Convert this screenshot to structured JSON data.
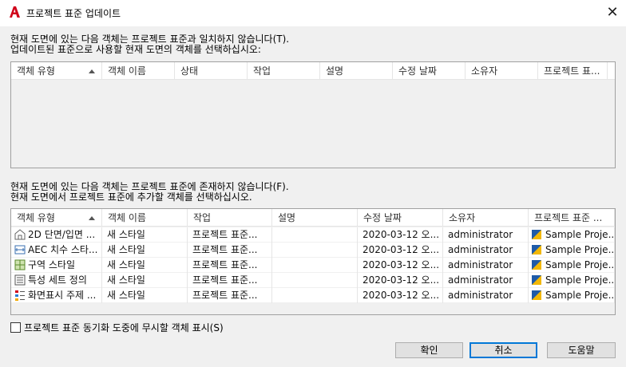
{
  "window": {
    "title": "프로젝트 표준 업데이트",
    "close_glyph": "✕"
  },
  "section1": {
    "prompt_line1": "현재 도면에 있는 다음 객체는 프로젝트 표준과 일치하지 않습니다(T).",
    "prompt_line2": "업데이트된 표준으로 사용할 현재 도면의 객체를 선택하십시오:",
    "columns": [
      "객체 유형",
      "객체 이름",
      "상태",
      "작업",
      "설명",
      "수정 날짜",
      "소유자",
      "프로젝트 표..."
    ]
  },
  "section2": {
    "prompt_line1": "현재 도면에 있는 다음 객체는 프로젝트 표준에 존재하지 않습니다(F).",
    "prompt_line2": "현재 도면에서 프로젝트 표준에 추가할 객체를 선택하십시오.",
    "columns": [
      "객체 유형",
      "객체 이름",
      "작업",
      "설명",
      "수정 날짜",
      "소유자",
      "프로젝트 표준 ..."
    ],
    "rows": [
      {
        "icon": "section-elevation-icon",
        "type": "2D 단면/입면 ...",
        "name": "새 스타일",
        "action": "프로젝트 표준...",
        "desc": "",
        "modified": "2020-03-12 오...",
        "owner": "administrator",
        "project": "Sample Proje..."
      },
      {
        "icon": "aec-dimension-icon",
        "type": "AEC 치수 스타...",
        "name": "새 스타일",
        "action": "프로젝트 표준...",
        "desc": "",
        "modified": "2020-03-12 오...",
        "owner": "administrator",
        "project": "Sample Proje..."
      },
      {
        "icon": "zone-style-icon",
        "type": "구역 스타일",
        "name": "새 스타일",
        "action": "프로젝트 표준...",
        "desc": "",
        "modified": "2020-03-12 오...",
        "owner": "administrator",
        "project": "Sample Proje..."
      },
      {
        "icon": "property-set-icon",
        "type": "특성 세트 정의",
        "name": "새 스타일",
        "action": "프로젝트 표준...",
        "desc": "",
        "modified": "2020-03-12 오...",
        "owner": "administrator",
        "project": "Sample Proje..."
      },
      {
        "icon": "display-theme-icon",
        "type": "화면표시 주제 ...",
        "name": "새 스타일",
        "action": "프로젝트 표준...",
        "desc": "",
        "modified": "2020-03-12 오...",
        "owner": "administrator",
        "project": "Sample Proje..."
      }
    ]
  },
  "options": {
    "ignore_checkbox_label": "프로젝트 표준 동기화 도중에 무시할 객체 표시(S)",
    "ignore_checked": false
  },
  "buttons": {
    "ok": "확인",
    "cancel": "취소",
    "help": "도움말"
  },
  "colors": {
    "accent": "#0078d7",
    "app_icon": "#d0021b"
  }
}
